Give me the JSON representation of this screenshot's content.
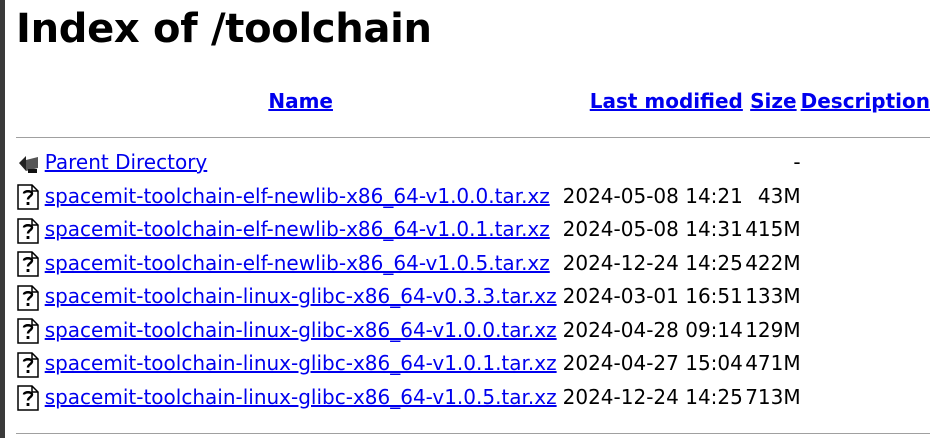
{
  "page": {
    "title": "Index of /toolchain"
  },
  "columns": {
    "name": "Name",
    "last_modified": "Last modified",
    "size": "Size",
    "description": "Description"
  },
  "parent": {
    "label": "Parent Directory",
    "size": "-",
    "icon": "back-folder-icon"
  },
  "files": [
    {
      "name": "spacemit-toolchain-elf-newlib-x86_64-v1.0.0.tar.xz",
      "modified": "2024-05-08 14:21",
      "size": "43M",
      "icon": "unknown-file-icon"
    },
    {
      "name": "spacemit-toolchain-elf-newlib-x86_64-v1.0.1.tar.xz",
      "modified": "2024-05-08 14:31",
      "size": "415M",
      "icon": "unknown-file-icon"
    },
    {
      "name": "spacemit-toolchain-elf-newlib-x86_64-v1.0.5.tar.xz",
      "modified": "2024-12-24 14:25",
      "size": "422M",
      "icon": "unknown-file-icon"
    },
    {
      "name": "spacemit-toolchain-linux-glibc-x86_64-v0.3.3.tar.xz",
      "modified": "2024-03-01 16:51",
      "size": "133M",
      "icon": "unknown-file-icon"
    },
    {
      "name": "spacemit-toolchain-linux-glibc-x86_64-v1.0.0.tar.xz",
      "modified": "2024-04-28 09:14",
      "size": "129M",
      "icon": "unknown-file-icon"
    },
    {
      "name": "spacemit-toolchain-linux-glibc-x86_64-v1.0.1.tar.xz",
      "modified": "2024-04-27 15:04",
      "size": "471M",
      "icon": "unknown-file-icon"
    },
    {
      "name": "spacemit-toolchain-linux-glibc-x86_64-v1.0.5.tar.xz",
      "modified": "2024-12-24 14:25",
      "size": "713M",
      "icon": "unknown-file-icon"
    }
  ],
  "colors": {
    "link": "#0000ee",
    "separator": "#a0a0a0",
    "window_edge": "#3a3a3a"
  }
}
